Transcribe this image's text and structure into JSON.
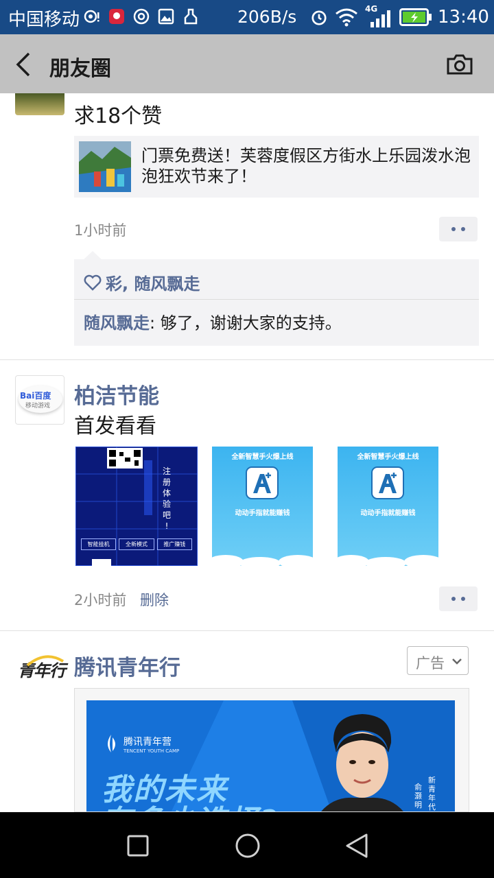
{
  "status_bar": {
    "carrier": "中国移动",
    "network_speed": "206B/s",
    "network_type": "4G",
    "time": "13:40"
  },
  "header": {
    "title": "朋友圈"
  },
  "posts": [
    {
      "text": "求18个赞",
      "link_card": {
        "title": "门票免费送！芙蓉度假区方街水上乐园泼水泡泡狂欢节来了！"
      },
      "time": "1小时前",
      "likes": "彩, 随风飘走",
      "comments": [
        {
          "author": "随风飘走",
          "text": ": 够了，谢谢大家的支持。"
        }
      ]
    },
    {
      "author": "柏洁节能",
      "avatar_text": {
        "brand": "Bai百度",
        "sub": "移动游戏"
      },
      "text": "首发看看",
      "images": [
        {
          "lines": [
            "注",
            "册",
            "体",
            "验",
            "吧",
            "!"
          ],
          "buttons": [
            "智能挂机",
            "全新模式",
            "推广赚钱"
          ]
        },
        {
          "top": "全新智慧手火爆上线",
          "bottom": "动动手指就能赚钱"
        },
        {
          "top": "全新智慧手火爆上线",
          "bottom": "动动手指就能赚钱"
        }
      ],
      "time": "2小时前",
      "delete_label": "删除"
    },
    {
      "author": "腾讯青年行",
      "avatar_text": "青年行",
      "ad_label": "广告",
      "banner": {
        "brand": "腾讯青年营",
        "brand_en": "TENCENT YOUTH CAMP",
        "slogan_1": "我的未来",
        "slogan_2": "有多少选择?",
        "side_1": "新青年代",
        "side_2": "俞灏明"
      }
    }
  ],
  "colors": {
    "status_bar": "#184a86",
    "title_bar": "#c1c1c1",
    "link_name": "#576b95",
    "nav_bar": "#000000"
  }
}
